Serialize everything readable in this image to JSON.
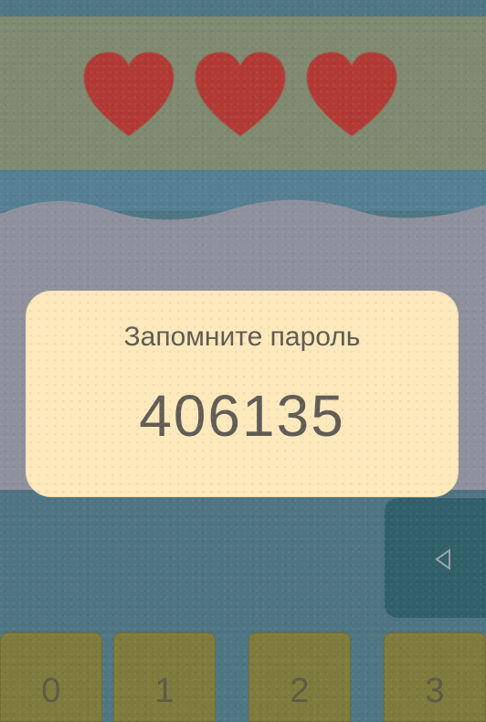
{
  "hearts": [
    {
      "icon": "heart-icon"
    },
    {
      "icon": "heart-icon"
    },
    {
      "icon": "heart-icon"
    }
  ],
  "dialog": {
    "title": "Запомните пароль",
    "password": "406135"
  },
  "backspace": {
    "icon": "backspace-icon"
  },
  "keys": [
    {
      "label": "0"
    },
    {
      "label": "1"
    },
    {
      "label": "2"
    },
    {
      "label": "3"
    }
  ],
  "colors": {
    "heart": "#b23a35",
    "dialog": "#fde9bb",
    "key": "#7e7b3c",
    "background": "#4f7683"
  }
}
